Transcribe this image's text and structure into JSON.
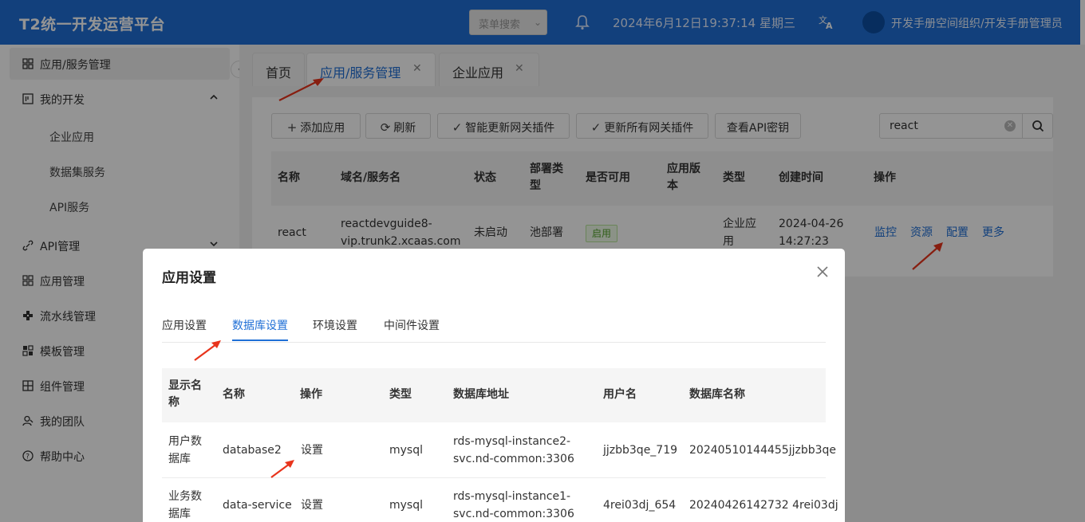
{
  "header": {
    "title": "T2统一开发运营平台",
    "menu_search_placeholder": "菜单搜索",
    "datetime": "2024年6月12日19:37:14 星期三",
    "user": "开发手册空间组织/开发手册管理员"
  },
  "sidebar": {
    "items": [
      {
        "label": "应用/服务管理",
        "icon": "grid-icon"
      },
      {
        "label": "我的开发",
        "icon": "board-icon"
      },
      {
        "label": "API管理",
        "icon": "link-icon"
      },
      {
        "label": "应用管理",
        "icon": "apps-icon"
      },
      {
        "label": "流水线管理",
        "icon": "pipeline-icon"
      },
      {
        "label": "模板管理",
        "icon": "template-icon"
      },
      {
        "label": "组件管理",
        "icon": "component-icon"
      },
      {
        "label": "我的团队",
        "icon": "team-icon"
      },
      {
        "label": "帮助中心",
        "icon": "help-icon"
      }
    ],
    "sub_items": [
      "企业应用",
      "数据集服务",
      "API服务"
    ]
  },
  "tabs": [
    {
      "label": "首页"
    },
    {
      "label": "应用/服务管理"
    },
    {
      "label": "企业应用"
    }
  ],
  "toolbar": {
    "add": "添加应用",
    "refresh": "刷新",
    "smart_update": "智能更新网关插件",
    "update_all": "更新所有网关插件",
    "view_key": "查看API密钥"
  },
  "search": {
    "value": "react"
  },
  "table": {
    "columns": [
      "名称",
      "域名/服务名",
      "状态",
      "部署类型",
      "是否可用",
      "应用版本",
      "类型",
      "创建时间",
      "操作"
    ],
    "row": {
      "name": "react",
      "domain_line1": "reactdevguide8-",
      "domain_line2": "vip.trunk2.xcaas.com",
      "status": "未启动",
      "deploy": "池部署",
      "available": "启用",
      "version": "",
      "type_line1": "企业应",
      "type_line2": "用",
      "created_date": "2024-04-26",
      "created_time": "14:27:23",
      "actions": [
        "监控",
        "资源",
        "配置",
        "更多"
      ]
    }
  },
  "modal": {
    "title": "应用设置",
    "tabs": [
      "应用设置",
      "数据库设置",
      "环境设置",
      "中间件设置"
    ],
    "columns": [
      "显示名称",
      "名称",
      "操作",
      "类型",
      "数据库地址",
      "用户名",
      "数据库名称"
    ],
    "rows": [
      {
        "display_1": "用户数",
        "display_2": "据库",
        "name": "database2",
        "action": "设置",
        "type": "mysql",
        "addr_1": "rds-mysql-instance2-",
        "addr_2": "svc.nd-common:3306",
        "user": "jjzbb3qe_719",
        "dbname": "20240510144455jjzbb3qe"
      },
      {
        "display_1": "业务数",
        "display_2": "据库",
        "name": "data-service",
        "action": "设置",
        "type": "mysql",
        "addr_1": "rds-mysql-instance1-",
        "addr_2": "svc.nd-common:3306",
        "user": "4rei03dj_654",
        "dbname": "20240426142732 4rei03dj"
      }
    ]
  },
  "colors": {
    "primary": "#1f6fd6",
    "arrow": "#e8341c",
    "success": "#52a32a"
  }
}
